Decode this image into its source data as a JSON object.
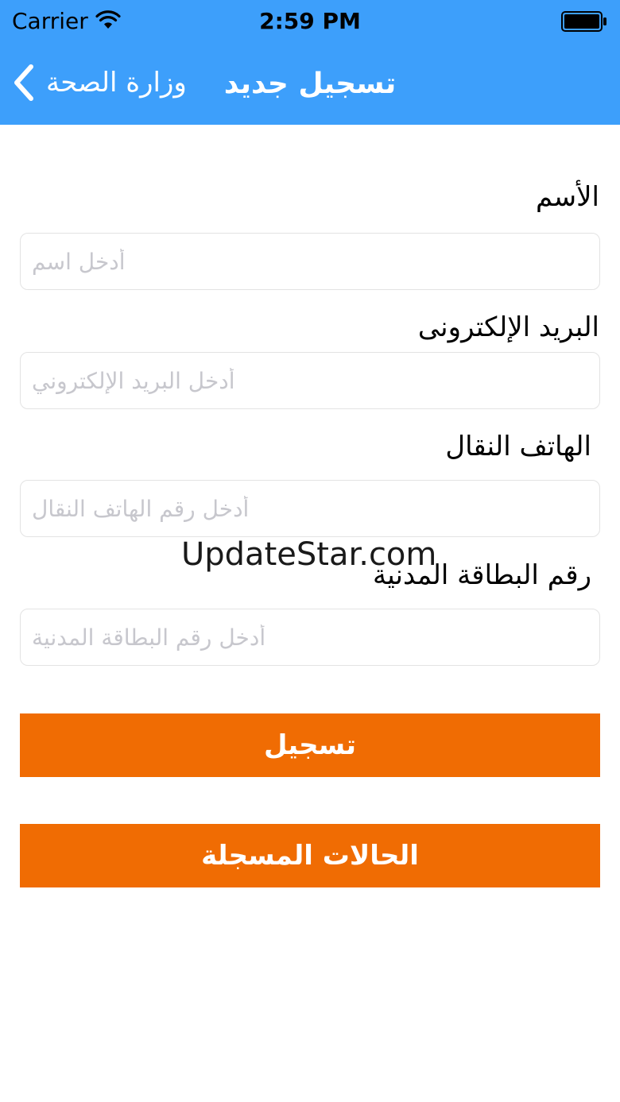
{
  "status_bar": {
    "carrier": "Carrier",
    "time": "2:59 PM"
  },
  "navbar": {
    "back_label": "وزارة الصحة",
    "title": "تسجيل جديد",
    "background_color": "#3d9ffb"
  },
  "form": {
    "name": {
      "label": "الأسم",
      "placeholder": "أدخل اسم"
    },
    "email": {
      "label": "البريد الإلكترونى",
      "placeholder": "أدخل البريد الإلكتروني"
    },
    "phone": {
      "label": "الهاتف النقال",
      "placeholder": "أدخل رقم الهاتف النقال"
    },
    "civil_id": {
      "label": "رقم البطاقة المدنية",
      "placeholder": "أدخل رقم البطاقة المدنية"
    }
  },
  "buttons": {
    "register_label": "تسجيل",
    "registered_cases_label": "الحالات المسجلة",
    "color": "#f06c03"
  },
  "watermark": "UpdateStar.com",
  "icons": {
    "wifi": "wifi-icon",
    "battery": "battery-icon",
    "back": "chevron-left-icon"
  }
}
